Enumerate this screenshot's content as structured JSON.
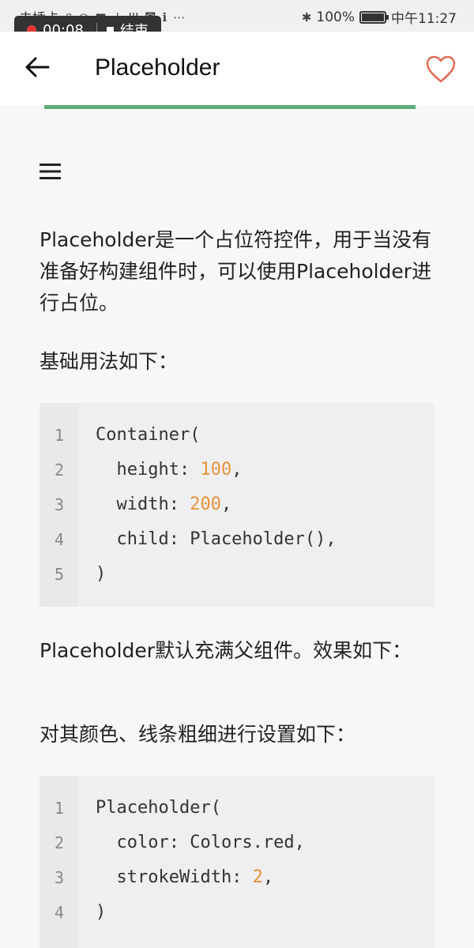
{
  "status_bar": {
    "carrier": "未插卡",
    "battery_percent": "100%",
    "battery_level": 1.0,
    "time": "中午11:27",
    "recording": {
      "elapsed": "00:08",
      "stop_label": "结束"
    }
  },
  "app_bar": {
    "title": "Placeholder",
    "progress": 1.0,
    "colors": {
      "progress": "#5fae78",
      "favorite": "#e06b52"
    }
  },
  "content": {
    "intro": "Placeholder是一个占位符控件，用于当没有准备好构建组件时，可以使用Placeholder进行占位。",
    "basic_usage": "基础用法如下：",
    "code1": [
      {
        "n": "1",
        "pre": "Container(",
        "num": "",
        "post": ""
      },
      {
        "n": "2",
        "pre": "  height: ",
        "num": "100",
        "post": ","
      },
      {
        "n": "3",
        "pre": "  width: ",
        "num": "200",
        "post": ","
      },
      {
        "n": "4",
        "pre": "  child: Placeholder(),",
        "num": "",
        "post": ""
      },
      {
        "n": "5",
        "pre": ")",
        "num": "",
        "post": ""
      }
    ],
    "default_fill": "Placeholder默认充满父组件。效果如下：",
    "settings": "对其颜色、线条粗细进行设置如下：",
    "code2": [
      {
        "n": "1",
        "pre": "Placeholder(",
        "num": "",
        "post": ""
      },
      {
        "n": "2",
        "pre": "  color: Colors.red,",
        "num": "",
        "post": ""
      },
      {
        "n": "3",
        "pre": "  strokeWidth: ",
        "num": "2",
        "post": ","
      },
      {
        "n": "4",
        "pre": ")",
        "num": "",
        "post": ""
      }
    ]
  }
}
